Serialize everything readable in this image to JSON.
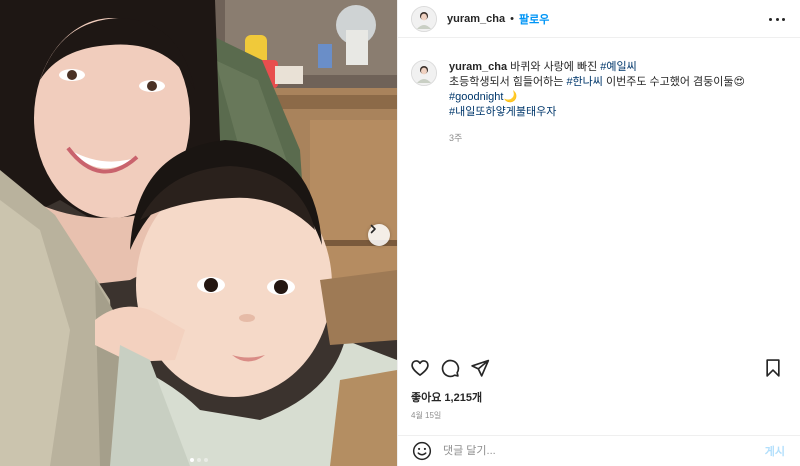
{
  "post": {
    "image_alt": "",
    "carousel": {
      "next_icon": "chevron-right-icon",
      "dots_count": 3,
      "active_dot": 0
    }
  },
  "header": {
    "username": "yuram_cha",
    "separator": "•",
    "follow_label": "팔로우",
    "more_icon": "more-horizontal-icon"
  },
  "caption": {
    "username": "yuram_cha",
    "segments": [
      {
        "text": "바퀴와 사랑에 빠진 ",
        "type": "text"
      },
      {
        "text": "#예일씨",
        "type": "tag"
      },
      {
        "text": "초등학생되서 힘들어하는 ",
        "type": "text"
      },
      {
        "text": "#한나씨",
        "type": "tag"
      },
      {
        "text": " 이번주도 수고했어 겸둥이둘😍",
        "type": "text"
      },
      {
        "text": "#goodnight",
        "type": "tag"
      },
      {
        "text": "🌙",
        "type": "text"
      },
      {
        "text": "#내일또하얗게불태우자",
        "type": "tag"
      }
    ],
    "time_ago": "3주"
  },
  "actions": {
    "like_icon": "heart-icon",
    "comment_icon": "comment-icon",
    "share_icon": "share-icon",
    "save_icon": "bookmark-icon"
  },
  "likes": {
    "label": "좋아요 1,215개"
  },
  "date": {
    "label": "4월 15일"
  },
  "comment_box": {
    "emoji_icon": "smile-icon",
    "placeholder": "댓글 달기...",
    "post_label": "게시"
  },
  "colors": {
    "accent": "#0095f6",
    "hashtag": "#00376b",
    "post_disabled": "#b2dffc",
    "secondary_text": "#8e8e8e"
  }
}
